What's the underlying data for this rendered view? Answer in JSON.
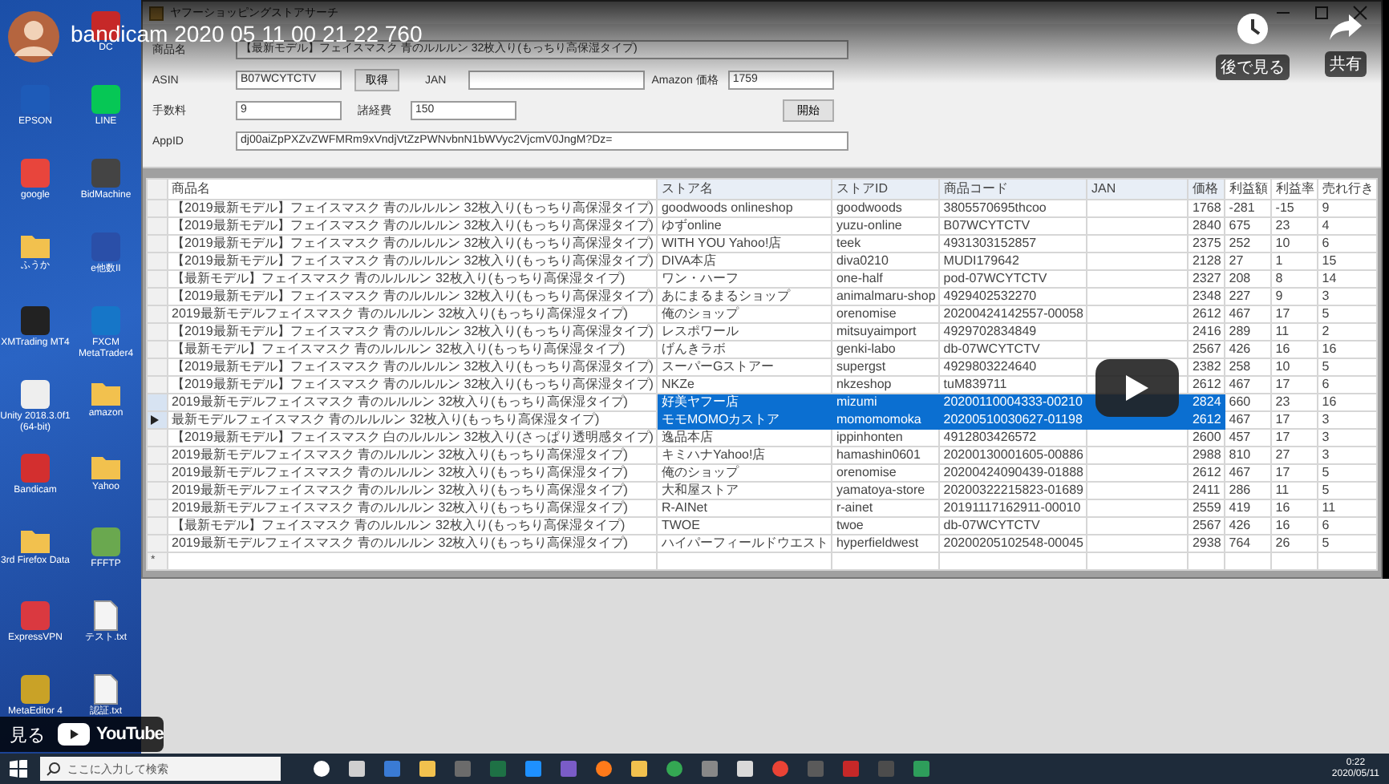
{
  "youtube": {
    "title": "bandicam 2020 05 11 00 21 22 760",
    "actions": [
      {
        "kind": "clock",
        "label": "後で見る"
      },
      {
        "kind": "share",
        "label": "共有"
      }
    ],
    "watch_on": {
      "label": "見る",
      "brand": "YouTube"
    }
  },
  "desktop": {
    "icons": [
      {
        "label": "DC",
        "kind": "app",
        "color": "#c62828"
      },
      {
        "label": "EPSON",
        "kind": "app",
        "color": "#1e5bb8"
      },
      {
        "label": "LINE",
        "kind": "app",
        "color": "#06c755"
      },
      {
        "label": "google",
        "kind": "app",
        "color": "#e8453c"
      },
      {
        "label": "BidMachine",
        "kind": "app",
        "color": "#444444"
      },
      {
        "label": "ふうか",
        "kind": "folder",
        "color": "#f2c14e"
      },
      {
        "label": "e他数II",
        "kind": "app",
        "color": "#2a4fa8"
      },
      {
        "label": "XMTrading MT4",
        "kind": "app",
        "color": "#222222"
      },
      {
        "label": "FXCM MetaTrader4",
        "kind": "app",
        "color": "#1676c8"
      },
      {
        "label": "Unity 2018.3.0f1 (64-bit)",
        "kind": "app",
        "color": "#eeeeee"
      },
      {
        "label": "amazon",
        "kind": "folder",
        "color": "#f2c14e"
      },
      {
        "label": "Bandicam",
        "kind": "app",
        "color": "#d32f2f"
      },
      {
        "label": "Yahoo",
        "kind": "folder",
        "color": "#f2c14e"
      },
      {
        "label": "3rd Firefox Data",
        "kind": "folder",
        "color": "#f2c14e"
      },
      {
        "label": "FFFTP",
        "kind": "app",
        "color": "#6aa84f"
      },
      {
        "label": "ExpressVPN",
        "kind": "app",
        "color": "#da3940"
      },
      {
        "label": "テスト.txt",
        "kind": "document",
        "color": "#f4f4f4"
      },
      {
        "label": "MetaEditor 4",
        "kind": "app",
        "color": "#c9a227"
      },
      {
        "label": "認証.txt",
        "kind": "document",
        "color": "#f4f4f4"
      }
    ]
  },
  "window": {
    "title": "ヤフーショッピングストアサーチ"
  },
  "form": {
    "product_name": {
      "label": "商品名",
      "value": "【最新モデル】フェイスマスク 青のルルルン 32枚入り(もっちり高保湿タイプ)"
    },
    "asin": {
      "label": "ASIN",
      "value": "B07WCYTCTV"
    },
    "fetch_button": "取得",
    "jan": {
      "label": "JAN"
    },
    "amazon_price": {
      "label": "Amazon 価格",
      "value": "1759"
    },
    "fee": {
      "label": "手数料",
      "value": "9"
    },
    "expenses": {
      "label": "諸経費",
      "value": "150"
    },
    "start_button": "開始",
    "app_id": {
      "label": "AppID",
      "value": "dj00aiZpPXZvZWFMRm9xVndjVtZzPWNvbnN1bWVyc2VjcmV0JngM?Dz="
    }
  },
  "grid": {
    "columns": [
      {
        "label": "商品名",
        "in_selection": false
      },
      {
        "label": "ストア名",
        "in_selection": true
      },
      {
        "label": "ストアID",
        "in_selection": true
      },
      {
        "label": "商品コード",
        "in_selection": true
      },
      {
        "label": "JAN",
        "in_selection": true
      },
      {
        "label": "価格",
        "in_selection": true
      },
      {
        "label": "利益額",
        "in_selection": false
      },
      {
        "label": "利益率",
        "in_selection": false
      },
      {
        "label": "売れ行き",
        "in_selection": false
      }
    ],
    "rows": [
      {
        "selected": false,
        "current": false,
        "cells": [
          "【2019最新モデル】フェイスマスク 青のルルルン 32枚入り(もっちり高保湿タイプ)",
          "goodwoods onlineshop",
          "goodwoods",
          "3805570695thcoo",
          null,
          "1768",
          "-281",
          "-15",
          "9"
        ]
      },
      {
        "selected": false,
        "current": false,
        "cells": [
          "【2019最新モデル】フェイスマスク 青のルルルン 32枚入り(もっちり高保湿タイプ)",
          "ゆずonline",
          "yuzu-online",
          "B07WCYTCTV",
          null,
          "2840",
          "675",
          "23",
          "4"
        ]
      },
      {
        "selected": false,
        "current": false,
        "cells": [
          "【2019最新モデル】フェイスマスク 青のルルルン 32枚入り(もっちり高保湿タイプ)",
          "WITH YOU Yahoo!店",
          "teek",
          "4931303152857",
          null,
          "2375",
          "252",
          "10",
          "6"
        ]
      },
      {
        "selected": false,
        "current": false,
        "cells": [
          "【2019最新モデル】フェイスマスク 青のルルルン 32枚入り(もっちり高保湿タイプ)",
          "DIVA本店",
          "diva0210",
          "MUDI179642",
          null,
          "2128",
          "27",
          "1",
          "15"
        ]
      },
      {
        "selected": false,
        "current": false,
        "cells": [
          "【最新モデル】フェイスマスク 青のルルルン 32枚入り(もっちり高保湿タイプ)",
          "ワン・ハーフ",
          "one-half",
          "pod-07WCYTCTV",
          null,
          "2327",
          "208",
          "8",
          "14"
        ]
      },
      {
        "selected": false,
        "current": false,
        "cells": [
          "【2019最新モデル】フェイスマスク 青のルルルン 32枚入り(もっちり高保湿タイプ)",
          "あにまるまるショップ",
          "animalmaru-shop",
          "4929402532270",
          null,
          "2348",
          "227",
          "9",
          "3"
        ]
      },
      {
        "selected": false,
        "current": false,
        "cells": [
          "2019最新モデルフェイスマスク 青のルルルン 32枚入り(もっちり高保湿タイプ)",
          "俺のショップ",
          "orenomise",
          "20200424142557-00058",
          null,
          "2612",
          "467",
          "17",
          "5"
        ]
      },
      {
        "selected": false,
        "current": false,
        "cells": [
          "【2019最新モデル】フェイスマスク 青のルルルン 32枚入り(もっちり高保湿タイプ)",
          "レスポワール",
          "mitsuyaimport",
          "4929702834849",
          null,
          "2416",
          "289",
          "11",
          "2"
        ]
      },
      {
        "selected": false,
        "current": false,
        "cells": [
          "【最新モデル】フェイスマスク 青のルルルン 32枚入り(もっちり高保湿タイプ)",
          "げんきラボ",
          "genki-labo",
          "db-07WCYTCTV",
          null,
          "2567",
          "426",
          "16",
          "16"
        ]
      },
      {
        "selected": false,
        "current": false,
        "cells": [
          "【2019最新モデル】フェイスマスク 青のルルルン 32枚入り(もっちり高保湿タイプ)",
          "スーパーGストアー",
          "supergst",
          "4929803224640",
          null,
          "2382",
          "258",
          "10",
          "5"
        ]
      },
      {
        "selected": false,
        "current": false,
        "cells": [
          "【2019最新モデル】フェイスマスク 青のルルルン 32枚入り(もっちり高保湿タイプ)",
          "NKZe",
          "nkzeshop",
          "tuM839711",
          null,
          "2612",
          "467",
          "17",
          "6"
        ]
      },
      {
        "selected": true,
        "current": false,
        "cells": [
          "2019最新モデルフェイスマスク 青のルルルン 32枚入り(もっちり高保湿タイプ)",
          "好美ヤフー店",
          "mizumi",
          "20200110004333-00210",
          null,
          "2824",
          "660",
          "23",
          "16"
        ]
      },
      {
        "selected": true,
        "current": true,
        "cells": [
          "最新モデルフェイスマスク 青のルルルン 32枚入り(もっちり高保湿タイプ)",
          "モモMOMOカストア",
          "momomomoka",
          "20200510030627-01198",
          null,
          "2612",
          "467",
          "17",
          "3"
        ]
      },
      {
        "selected": false,
        "current": false,
        "cells": [
          "【2019最新モデル】フェイスマスク 白のルルルン 32枚入り(さっぱり透明感タイプ)",
          "逸品本店",
          "ippinhonten",
          "4912803426572",
          null,
          "2600",
          "457",
          "17",
          "3"
        ]
      },
      {
        "selected": false,
        "current": false,
        "cells": [
          "2019最新モデルフェイスマスク 青のルルルン 32枚入り(もっちり高保湿タイプ)",
          "キミハナYahoo!店",
          "hamashin0601",
          "20200130001605-00886",
          null,
          "2988",
          "810",
          "27",
          "3"
        ]
      },
      {
        "selected": false,
        "current": false,
        "cells": [
          "2019最新モデルフェイスマスク 青のルルルン 32枚入り(もっちり高保湿タイプ)",
          "俺のショップ",
          "orenomise",
          "20200424090439-01888",
          null,
          "2612",
          "467",
          "17",
          "5"
        ]
      },
      {
        "selected": false,
        "current": false,
        "cells": [
          "2019最新モデルフェイスマスク 青のルルルン 32枚入り(もっちり高保湿タイプ)",
          "大和屋ストア",
          "yamatoya-store",
          "20200322215823-01689",
          null,
          "2411",
          "286",
          "11",
          "5"
        ]
      },
      {
        "selected": false,
        "current": false,
        "cells": [
          "2019最新モデルフェイスマスク 青のルルルン 32枚入り(もっちり高保湿タイプ)",
          "R-AINet",
          "r-ainet",
          "20191117162911-00010",
          null,
          "2559",
          "419",
          "16",
          "11"
        ]
      },
      {
        "selected": false,
        "current": false,
        "cells": [
          "【最新モデル】フェイスマスク 青のルルルン 32枚入り(もっちり高保湿タイプ)",
          "TWOE",
          "twoe",
          "db-07WCYTCTV",
          null,
          "2567",
          "426",
          "16",
          "6"
        ]
      },
      {
        "selected": false,
        "current": false,
        "cells": [
          "2019最新モデルフェイスマスク 青のルルルン 32枚入り(もっちり高保湿タイプ)",
          "ハイパーフィールドウエスト",
          "hyperfieldwest",
          "20200205102548-00045",
          null,
          "2938",
          "764",
          "26",
          "5"
        ]
      }
    ],
    "new_row_marker": "*"
  },
  "taskbar": {
    "search_placeholder": "ここに入力して検索",
    "apps": [
      {
        "kind": "circle",
        "color": "#ffffff"
      },
      {
        "kind": "square",
        "color": "#cfcfcf"
      },
      {
        "kind": "square",
        "color": "#3a7bd5"
      },
      {
        "kind": "square",
        "color": "#f2c14e"
      },
      {
        "kind": "square",
        "color": "#6b6b6b"
      },
      {
        "kind": "square",
        "color": "#1e7145"
      },
      {
        "kind": "square",
        "color": "#1e90ff"
      },
      {
        "kind": "square",
        "color": "#7a5cc7"
      },
      {
        "kind": "circle",
        "color": "#ff7a1a"
      },
      {
        "kind": "square",
        "color": "#f2c14e"
      },
      {
        "kind": "circle",
        "color": "#34a853"
      },
      {
        "kind": "square",
        "color": "#888888"
      },
      {
        "kind": "square",
        "color": "#d9d9d9"
      },
      {
        "kind": "circle",
        "color": "#ea4335"
      },
      {
        "kind": "square",
        "color": "#5a5a5a"
      },
      {
        "kind": "square",
        "color": "#c62828"
      },
      {
        "kind": "square",
        "color": "#4c4c4c"
      },
      {
        "kind": "square",
        "color": "#2e9e5b"
      }
    ],
    "time": "0:22",
    "date": "2020/05/11"
  }
}
